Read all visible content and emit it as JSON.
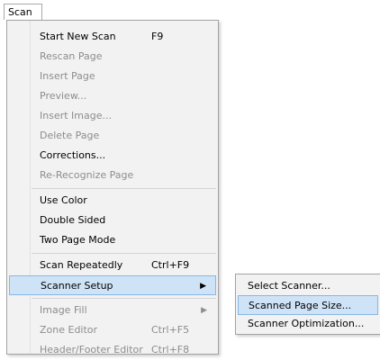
{
  "menubar": {
    "scan_label": "Scan"
  },
  "scan_menu": {
    "items": [
      {
        "label": "Start New Scan",
        "shortcut": "F9",
        "enabled": true
      },
      {
        "label": "Rescan Page",
        "shortcut": "",
        "enabled": false
      },
      {
        "label": "Insert Page",
        "shortcut": "",
        "enabled": false
      },
      {
        "label": "Preview...",
        "shortcut": "",
        "enabled": false
      },
      {
        "label": "Insert Image...",
        "shortcut": "",
        "enabled": false
      },
      {
        "label": "Delete Page",
        "shortcut": "",
        "enabled": false
      },
      {
        "label": "Corrections...",
        "shortcut": "",
        "enabled": true
      },
      {
        "label": "Re-Recognize Page",
        "shortcut": "",
        "enabled": false
      },
      {
        "label": "Use Color",
        "shortcut": "",
        "enabled": true
      },
      {
        "label": "Double Sided",
        "shortcut": "",
        "enabled": true
      },
      {
        "label": "Two Page Mode",
        "shortcut": "",
        "enabled": true
      },
      {
        "label": "Scan Repeatedly",
        "shortcut": "Ctrl+F9",
        "enabled": true
      },
      {
        "label": "Scanner Setup",
        "shortcut": "",
        "enabled": true,
        "highlighted": true,
        "submenu_arrow": "▶"
      },
      {
        "label": "Image Fill",
        "shortcut": "",
        "enabled": false,
        "submenu_arrow": "▶"
      },
      {
        "label": "Zone Editor",
        "shortcut": "Ctrl+F5",
        "enabled": false
      },
      {
        "label": "Header/Footer Editor",
        "shortcut": "Ctrl+F8",
        "enabled": false
      }
    ]
  },
  "scanner_setup_submenu": {
    "items": [
      {
        "label": "Select Scanner...",
        "highlighted": false
      },
      {
        "label": "Scanned Page Size...",
        "highlighted": true
      },
      {
        "label": "Scanner Optimization...",
        "highlighted": false
      }
    ]
  },
  "colors": {
    "menu_background": "#f2f2f2",
    "highlight_fill": "#cfe3f7",
    "highlight_border": "#87b6e6",
    "disabled_text": "#8d8d8d"
  }
}
